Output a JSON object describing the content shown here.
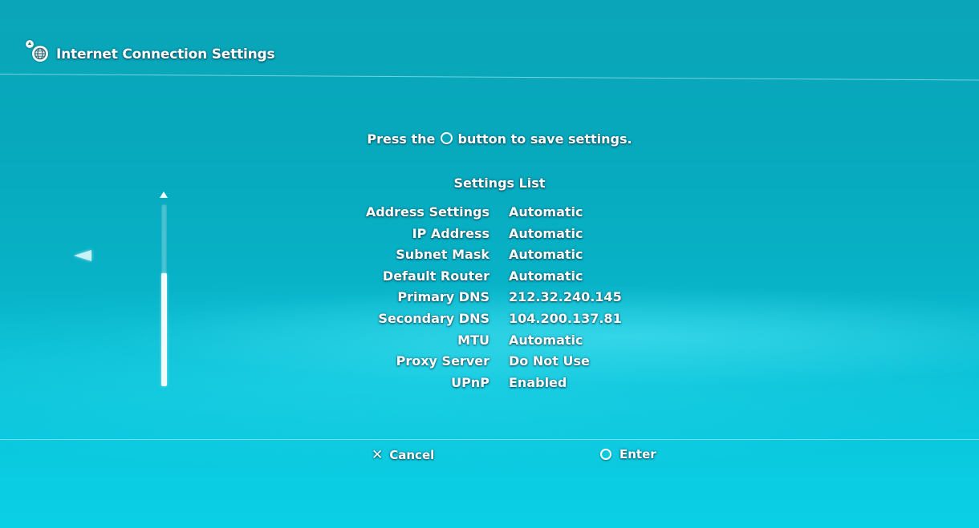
{
  "header": {
    "title": "Internet Connection Settings",
    "icon": "network-globe-icon"
  },
  "prompt": {
    "before": "Press the ",
    "button_icon": "circle-button-icon",
    "after": " button to save settings."
  },
  "settings_list": {
    "title": "Settings List",
    "rows": [
      {
        "label": "Address Settings",
        "value": "Automatic"
      },
      {
        "label": "IP Address",
        "value": "Automatic"
      },
      {
        "label": "Subnet Mask",
        "value": "Automatic"
      },
      {
        "label": "Default Router",
        "value": "Automatic"
      },
      {
        "label": "Primary DNS",
        "value": "212.32.240.145"
      },
      {
        "label": "Secondary DNS",
        "value": "104.200.137.81"
      },
      {
        "label": "MTU",
        "value": "Automatic"
      },
      {
        "label": "Proxy Server",
        "value": "Do Not Use"
      },
      {
        "label": "UPnP",
        "value": "Enabled"
      }
    ]
  },
  "scrollbar": {
    "thumb_start_fraction": 0.38,
    "thumb_end_fraction": 1.0
  },
  "footer": {
    "cancel_label": "Cancel",
    "cancel_icon": "cross-button-icon",
    "enter_label": "Enter",
    "enter_icon": "circle-button-icon"
  },
  "colors": {
    "background_top": "#0aa5b8",
    "background_bottom": "#0ad0e6",
    "text": "#ffffff"
  }
}
